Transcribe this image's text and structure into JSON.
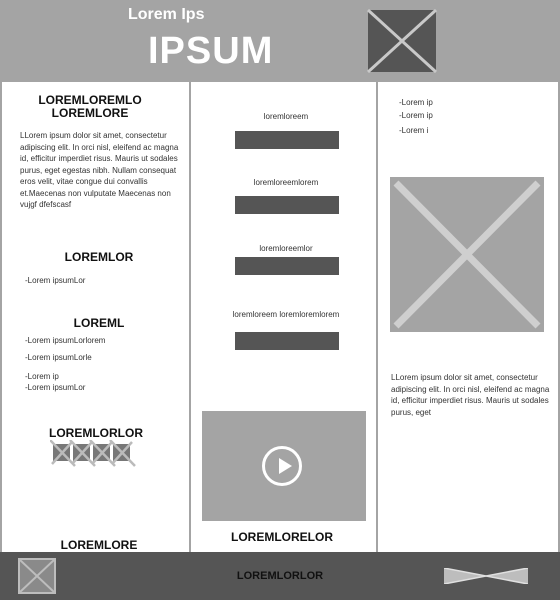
{
  "header": {
    "subtitle": "Lorem Ips",
    "title": "IPSUM"
  },
  "left": {
    "heading1": "LOREMLOREMLO LOREMLORE",
    "paragraph1": "LLorem ipsum dolor sit amet, consectetur adipiscing elit. In orci nisl, eleifend ac magna id, efficitur imperdiet risus. Mauris ut sodales purus, eget egestas nibh. Nullam consequat eros velit, vitae congue dui convallis et.Maecenas non vulputate Maecenas non vujgf dfefscasf",
    "heading2": "LOREMLOR",
    "list2": [
      "-Lorem ipsumLor"
    ],
    "heading3": "LOREML",
    "list3": [
      "-Lorem ipsumLorlorem",
      "-Lorem ipsumLorle",
      "-Lorem ip",
      "-Lorem ipsumLor"
    ],
    "heading4": "LOREMLORLOR",
    "heading5": "LOREMLORE"
  },
  "middle": {
    "labels": [
      "loremloreem",
      "loremloreemlorem",
      "loremloreemlor",
      "loremloreem loremloremlorem"
    ],
    "heading": "LOREMLORELOR"
  },
  "right": {
    "list": [
      "-Lorem ip",
      "-Lorem ip",
      "-Lorem i"
    ],
    "paragraph": "LLorem ipsum dolor sit amet, consectetur adipiscing elit. In orci nisl, eleifend ac magna id, efficitur imperdiet risus. Mauris ut sodales purus, eget"
  },
  "footer": {
    "title": "LOREMLORLOR"
  },
  "icons": {
    "header_image": "image-placeholder-icon",
    "video_play": "play-icon",
    "footer_image": "image-placeholder-icon",
    "footer_bow": "bowtie-icon"
  },
  "colors": {
    "header_bg": "#a4a4a4",
    "dark": "#555555",
    "placeholder": "#a4a4a4"
  }
}
